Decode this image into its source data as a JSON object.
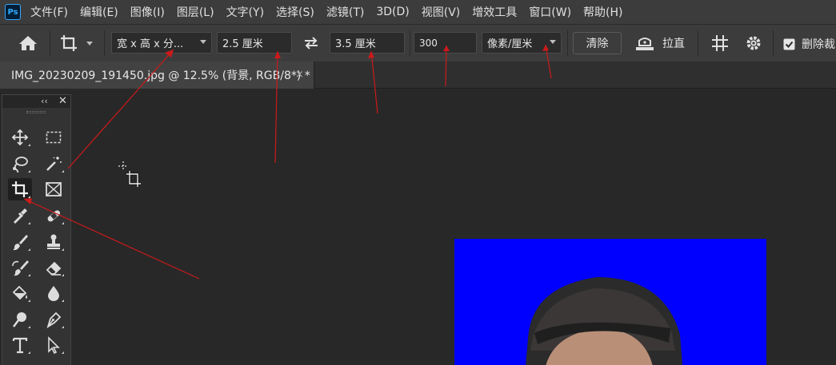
{
  "app": {
    "logo": "Ps"
  },
  "menu": [
    "文件(F)",
    "编辑(E)",
    "图像(I)",
    "图层(L)",
    "文字(Y)",
    "选择(S)",
    "滤镜(T)",
    "3D(D)",
    "视图(V)",
    "增效工具",
    "窗口(W)",
    "帮助(H)"
  ],
  "options": {
    "ratio_preset": "宽 x 高 x 分...",
    "width_value": "2.5 厘米",
    "height_value": "3.5 厘米",
    "resolution_value": "300",
    "resolution_unit": "像素/厘米",
    "clear_label": "清除",
    "straighten_label": "拉直",
    "delete_crop_label": "删除裁",
    "delete_crop_checked": true
  },
  "document": {
    "tab_title": "IMG_20230209_191450.jpg @ 12.5% (背景, RGB/8*) *",
    "close_glyph": "×"
  },
  "toolpanel": {
    "collapse_glyph": "‹‹",
    "close_glyph": "✕"
  },
  "tools": [
    {
      "name": "move-tool",
      "icon": "move-icon",
      "active": false
    },
    {
      "name": "marquee-tool",
      "icon": "rect-marquee-icon",
      "active": false
    },
    {
      "name": "lasso-tool",
      "icon": "lasso-icon",
      "active": false
    },
    {
      "name": "magic-wand-tool",
      "icon": "magic-wand-icon",
      "active": false
    },
    {
      "name": "crop-tool",
      "icon": "crop-icon",
      "active": true
    },
    {
      "name": "frame-tool",
      "icon": "frame-icon",
      "active": false
    },
    {
      "name": "eyedropper-tool",
      "icon": "eyedropper-icon",
      "active": false
    },
    {
      "name": "healing-tool",
      "icon": "bandage-icon",
      "active": false
    },
    {
      "name": "brush-tool",
      "icon": "brush-icon",
      "active": false
    },
    {
      "name": "stamp-tool",
      "icon": "stamp-icon",
      "active": false
    },
    {
      "name": "history-brush-tool",
      "icon": "history-brush-icon",
      "active": false
    },
    {
      "name": "eraser-tool",
      "icon": "eraser-icon",
      "active": false
    },
    {
      "name": "paint-bucket-tool",
      "icon": "paint-bucket-icon",
      "active": false
    },
    {
      "name": "blur-tool",
      "icon": "drop-icon",
      "active": false
    },
    {
      "name": "dodge-tool",
      "icon": "dodge-icon",
      "active": false
    },
    {
      "name": "pen-tool",
      "icon": "pen-icon",
      "active": false
    },
    {
      "name": "type-tool",
      "icon": "type-icon",
      "active": false
    },
    {
      "name": "path-select-tool",
      "icon": "arrow-icon",
      "active": false
    }
  ],
  "colors": {
    "photo_background": "#0000ff",
    "annotation": "#cc1a1a",
    "accent": "#31a8ff"
  }
}
